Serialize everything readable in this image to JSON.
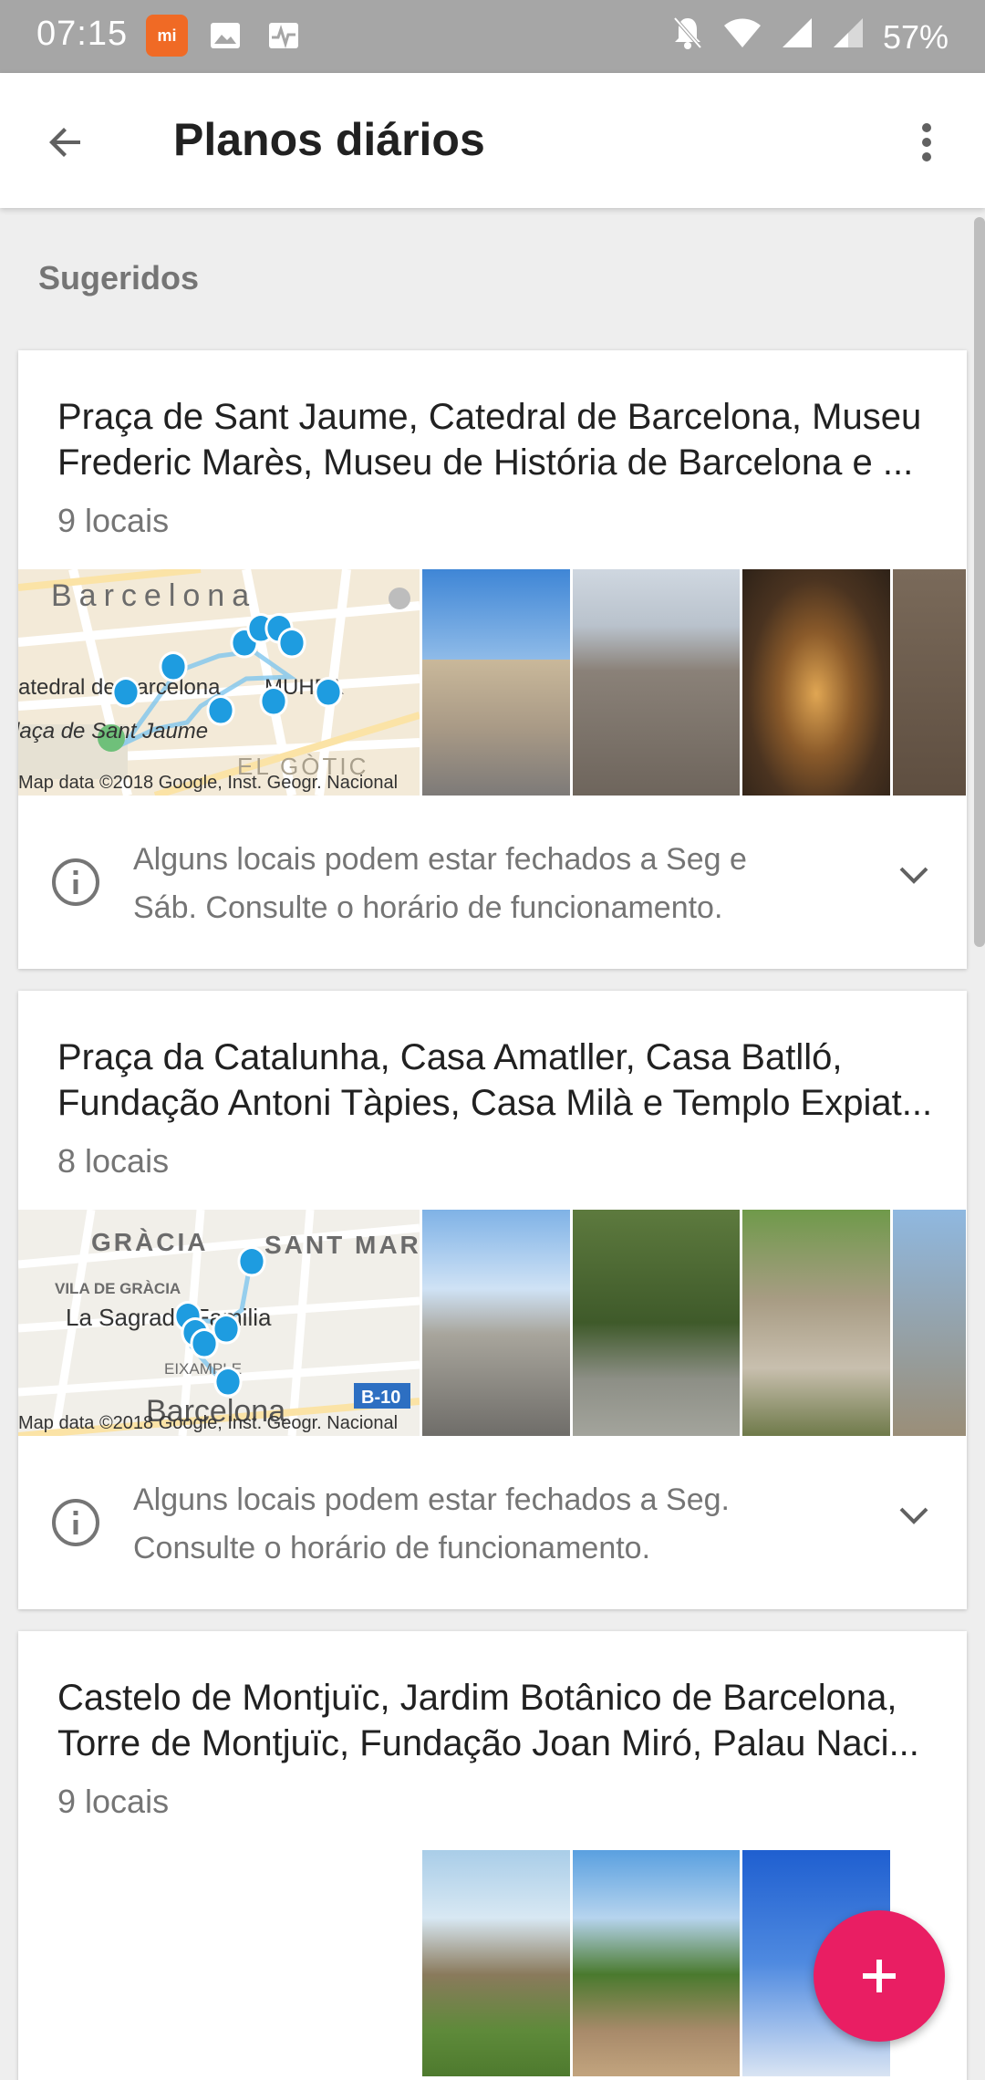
{
  "status_bar": {
    "time": "07:15",
    "battery": "57%"
  },
  "app_bar": {
    "title": "Planos diários"
  },
  "section_title": "Sugeridos",
  "cards": [
    {
      "title_line1": "Praça de Sant Jaume, Catedral de Barcelona, Museu",
      "title_line2": "Frederic Marès, Museu de História de Barcelona e ...",
      "count": "9 locais",
      "map_credit": "Map data ©2018 Google, Inst. Geogr. Nacional",
      "map_labels": [
        "Barcelona",
        "atedral de Barcelona",
        "MUHBA",
        "Plaça de Sant Jaume",
        "EL GÒTIC"
      ],
      "notice": "Alguns locais podem estar fechados a Seg e Sáb. Consulte o horário de funcionamento."
    },
    {
      "title_line1": "Praça da Catalunha, Casa Amatller, Casa Batlló,",
      "title_line2": "Fundação Antoni Tàpies, Casa Milà e Templo Expiat...",
      "count": "8 locais",
      "map_credit": "Map data ©2018 Google, Inst. Geogr. Nacional",
      "map_labels": [
        "GRÀCIA",
        "SANT MAR",
        "VILA DE GRÀCIA",
        "La Sagrada Familia",
        "EIXAMPLE",
        "Barcelona",
        "B-10"
      ],
      "notice": "Alguns locais podem estar fechados a Seg. Consulte o horário de funcionamento."
    },
    {
      "title_line1": "Castelo de Montjuïc, Jardim Botânico de Barcelona,",
      "title_line2": "Torre de Montjuïc, Fundação Joan Miró, Palau Naci...",
      "count": "9 locais"
    }
  ],
  "colors": {
    "accent": "#e91e63",
    "pin": "#1e9ce0",
    "status_bar": "#a6a6a6"
  },
  "icons": [
    "back-arrow-icon",
    "more-vert-icon",
    "info-icon",
    "chevron-down-icon",
    "plus-icon"
  ]
}
